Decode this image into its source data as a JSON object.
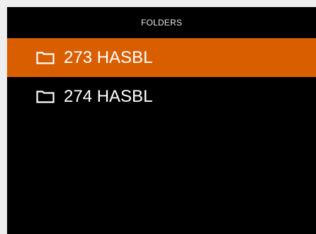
{
  "header": {
    "title": "FOLDERS"
  },
  "folders": [
    {
      "label": "273 HASBL",
      "selected": true,
      "icon": "folder-icon"
    },
    {
      "label": "274 HASBL",
      "selected": false,
      "icon": "folder-icon"
    }
  ],
  "colors": {
    "selection": "#d85e00",
    "background": "#000000",
    "text": "#ffffff"
  }
}
